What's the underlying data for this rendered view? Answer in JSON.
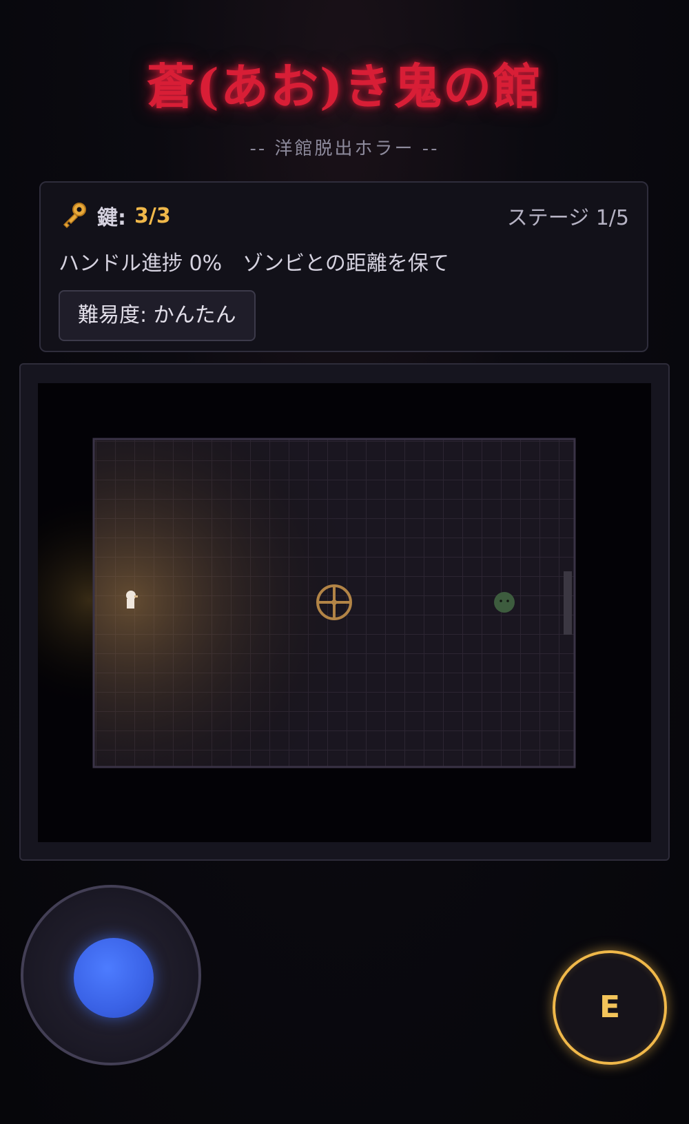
{
  "header": {
    "title": "蒼(あお)き鬼の館",
    "subtitle": "-- 洋館脱出ホラー --"
  },
  "status": {
    "key_label": "鍵:",
    "key_count": "3/3",
    "stage": "ステージ 1/5",
    "progress": "ハンドル進捗 0%　ゾンビとの距離を保て",
    "difficulty_label": "難易度: かんたん"
  },
  "controls": {
    "action_label": "E"
  },
  "colors": {
    "title_red": "#d81e36",
    "key_gold": "#f0b84a",
    "joystick_blue": "#3a62e6",
    "zombie_green": "#3d5c3e"
  }
}
